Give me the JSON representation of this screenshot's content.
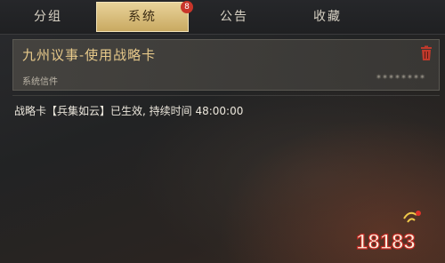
{
  "tabs": [
    {
      "label": "分组",
      "active": false
    },
    {
      "label": "系统",
      "active": true,
      "badge": "8"
    },
    {
      "label": "公告",
      "active": false
    },
    {
      "label": "收藏",
      "active": false
    }
  ],
  "mail": {
    "title": "九州议事-使用战略卡",
    "sender": "系统信件",
    "date": "********",
    "body": "战略卡【兵集如云】已生效, 持续时间 48:00:00"
  },
  "watermark": "18183",
  "colors": {
    "accent_gold": "#c9a961",
    "badge_red": "#c8352a",
    "title_gold": "#e7c98a",
    "trash_red": "#c0392b"
  }
}
